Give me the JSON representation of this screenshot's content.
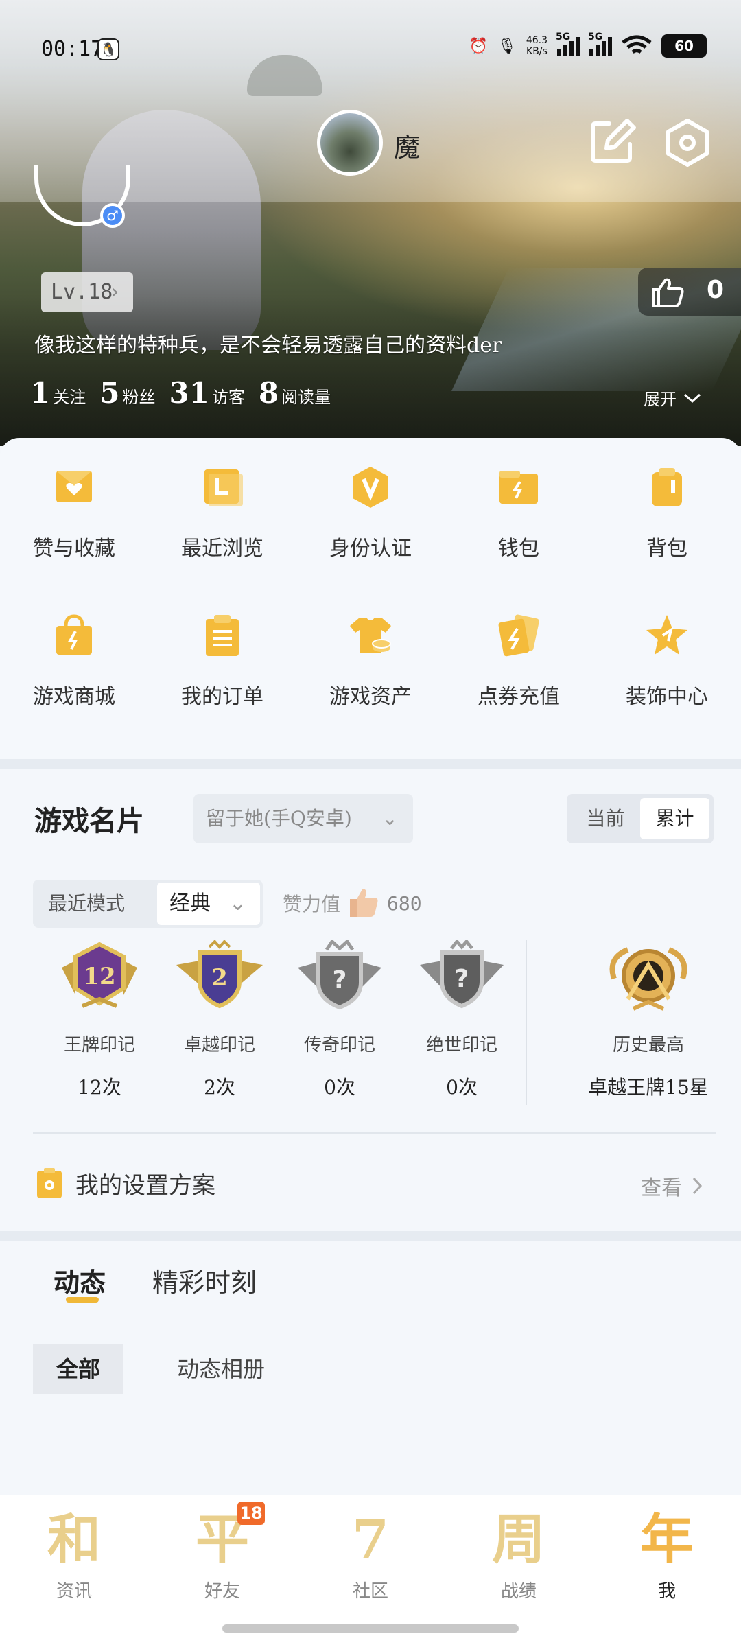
{
  "status_bar": {
    "time": "00:17",
    "net_speed": "46.3",
    "net_unit": "KB/s",
    "signal1": "5G",
    "signal2": "5G",
    "battery": "60"
  },
  "header": {
    "nickname": "魔",
    "level": "Lv.18",
    "likes": "0",
    "bio": "像我这样的特种兵，是不会轻易透露自己的资料der",
    "stats": [
      {
        "value": "1",
        "label": "关注"
      },
      {
        "value": "5",
        "label": "粉丝"
      },
      {
        "value": "31",
        "label": "访客"
      },
      {
        "value": "8",
        "label": "阅读量"
      }
    ],
    "expand": "展开"
  },
  "grid_menu": [
    {
      "label": "赞与收藏",
      "icon": "heart-folder-icon"
    },
    {
      "label": "最近浏览",
      "icon": "recent-icon"
    },
    {
      "label": "身份认证",
      "icon": "verify-icon"
    },
    {
      "label": "钱包",
      "icon": "wallet-icon"
    },
    {
      "label": "背包",
      "icon": "backpack-icon"
    },
    {
      "label": "游戏商城",
      "icon": "shop-bag-icon"
    },
    {
      "label": "我的订单",
      "icon": "clipboard-icon"
    },
    {
      "label": "游戏资产",
      "icon": "shirt-coins-icon"
    },
    {
      "label": "点券充值",
      "icon": "cards-icon"
    },
    {
      "label": "装饰中心",
      "icon": "star-icon"
    }
  ],
  "game_card": {
    "title": "游戏名片",
    "account": "留于她(手Q安卓)",
    "segments": [
      "当前",
      "累计"
    ],
    "mode_label": "最近模式",
    "mode_value": "经典",
    "praise_label": "赞力值",
    "praise_value": "680",
    "badges": [
      {
        "name": "王牌印记",
        "count": "12次"
      },
      {
        "name": "卓越印记",
        "count": "2次"
      },
      {
        "name": "传奇印记",
        "count": "0次"
      },
      {
        "name": "绝世印记",
        "count": "0次"
      }
    ],
    "best": {
      "name": "历史最高",
      "value": "卓越王牌15星"
    },
    "plan_label": "我的设置方案",
    "plan_action": "查看"
  },
  "tabs": [
    "动态",
    "精彩时刻"
  ],
  "filters": [
    "全部",
    "动态相册"
  ],
  "bottom_nav": [
    {
      "glyph": "和",
      "label": "资讯"
    },
    {
      "glyph": "平",
      "label": "好友"
    },
    {
      "glyph": "7",
      "label": "社区"
    },
    {
      "glyph": "周",
      "label": "战绩"
    },
    {
      "glyph": "年",
      "label": "我"
    }
  ],
  "friend_badge": "18",
  "colors": {
    "accent": "#f0b838",
    "panel": "#f5f8fc",
    "badge_orange": "#f06a2a"
  }
}
